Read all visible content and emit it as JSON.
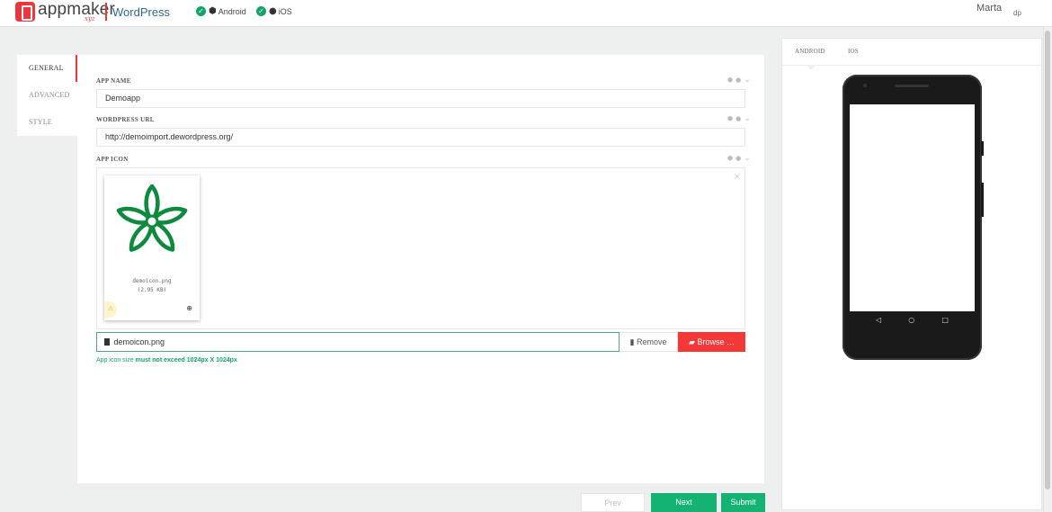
{
  "header": {
    "brand": "appmaker",
    "brand_suffix": "xyz",
    "platform": "WordPress",
    "statuses": [
      {
        "label": "Android",
        "glyph": "android-icon"
      },
      {
        "label": "iOS",
        "glyph": "apple-icon"
      }
    ],
    "user_name": "Marta",
    "user_initials": "dp"
  },
  "tabs": [
    {
      "label": "GENERAL",
      "active": true
    },
    {
      "label": "ADVANCED",
      "active": false
    },
    {
      "label": "STYLE",
      "active": false
    }
  ],
  "form": {
    "app_name": {
      "label": "APP NAME",
      "value": "Demoapp"
    },
    "wordpress_url": {
      "label": "WORDPRESS URL",
      "value": "http://demoimport.dewordpress.org/"
    },
    "app_icon": {
      "label": "APP ICON",
      "file_name": "demoicon.png",
      "file_size": "(2.95 KB)",
      "caption": "demoicon.png",
      "remove_label": "Remove",
      "browse_label": "Browse …",
      "hint_prefix": "App icon size ",
      "hint_bold": "must not exceed 1024px X 1024px",
      "close_glyph": "×"
    }
  },
  "buttons": {
    "prev": "Prev",
    "next": "Next",
    "submit": "Submit"
  },
  "preview": {
    "tabs": [
      "ANDROID",
      "IOS"
    ],
    "active_tab": "ANDROID"
  },
  "colors": {
    "accent_red": "#e8383d",
    "browse_red": "#f43838",
    "success_green": "#14b374",
    "hint_green": "#14a46a",
    "icon_green": "#0d8a3d"
  }
}
